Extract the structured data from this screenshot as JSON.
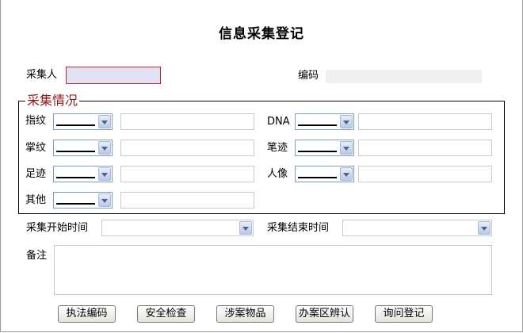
{
  "page": {
    "title": "信息采集登记"
  },
  "header_fields": {
    "collector_label": "采集人",
    "collector_value": "",
    "code_label": "编码",
    "code_value": ""
  },
  "collection_section": {
    "legend": "采集情况",
    "rows": [
      {
        "label": "指纹",
        "value": ""
      },
      {
        "label": "掌纹",
        "value": ""
      },
      {
        "label": "足迹",
        "value": ""
      },
      {
        "label": "其他",
        "value": ""
      },
      {
        "label": "DNA",
        "value": ""
      },
      {
        "label": "笔迹",
        "value": ""
      },
      {
        "label": "人像",
        "value": ""
      }
    ]
  },
  "time_fields": {
    "start_label": "采集开始时间",
    "start_value": "",
    "end_label": "采集结束时间",
    "end_value": ""
  },
  "remarks": {
    "label": "备注",
    "value": ""
  },
  "buttons": {
    "law_code": "执法编码",
    "security_check": "安全检查",
    "case_items": "涉案物品",
    "case_area_identify": "办案区辨认",
    "inquiry_register": "询问登记"
  }
}
